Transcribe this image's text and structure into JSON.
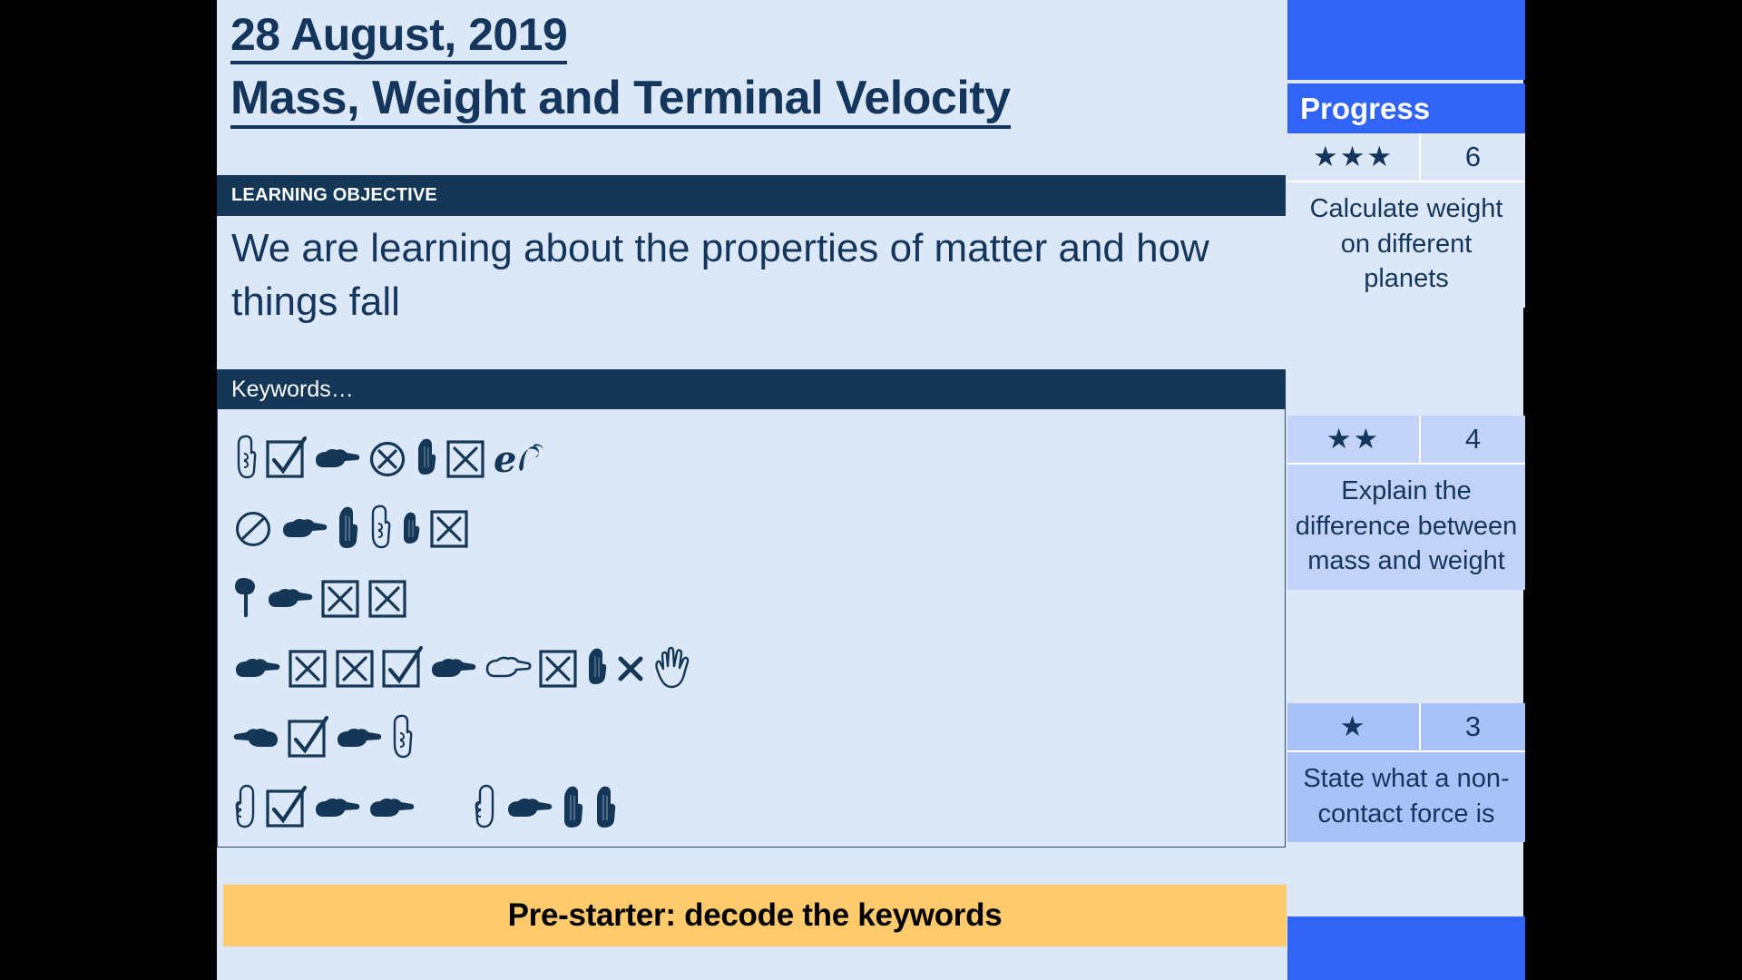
{
  "slide": {
    "date_title": "28 August, 2019",
    "topic_title": "Mass, Weight and Terminal Velocity",
    "learning_objective_label": "LEARNING OBJECTIVE",
    "learning_objective_text": "We are learning about the properties of matter and how things fall",
    "keywords_label": "Keywords…",
    "banner_text": "Pre-starter: decode the keywords",
    "colors": {
      "slide_background": "#dce8f7",
      "dark_bar": "#143757",
      "title_text": "#14365c",
      "banner_background": "#ffca6b",
      "banner_text": "#000000",
      "panel_accent": "#3163f5"
    }
  },
  "keywords_cipher": {
    "note": "Wingdings-style symbol rows that encode hidden keywords",
    "rows": [
      {
        "groups": [
          {
            "symbols": [
              "hand-point-down-outline",
              "checkbox-checked",
              "hand-point-right-filled",
              "circle-x",
              "hand-point-up-filled-small",
              "checkbox-x",
              "ampersand-script"
            ]
          }
        ]
      },
      {
        "groups": [
          {
            "symbols": [
              "circle-slash",
              "hand-point-right-filled",
              "hand-point-up-filled",
              "hand-point-down-outline",
              "hand-point-up-filled-short",
              "checkbox-x"
            ]
          }
        ]
      },
      {
        "groups": [
          {
            "symbols": [
              "hand-point-down-filled-small",
              "hand-point-right-filled",
              "checkbox-x",
              "checkbox-x"
            ]
          }
        ]
      },
      {
        "groups": [
          {
            "symbols": [
              "hand-point-right-filled",
              "checkbox-x",
              "checkbox-x",
              "checkbox-checked",
              "hand-point-right-filled",
              "hand-point-right-outline",
              "checkbox-x",
              "hand-point-up-filled-small",
              "x-mark",
              "open-hand-outline"
            ]
          }
        ]
      },
      {
        "groups": [
          {
            "symbols": [
              "hand-point-left-filled",
              "checkbox-checked",
              "hand-point-right-filled",
              "hand-point-down-outline"
            ]
          }
        ]
      },
      {
        "groups": [
          {
            "symbols": [
              "hand-point-up-outline",
              "checkbox-checked",
              "hand-point-right-filled",
              "hand-point-right-filled"
            ]
          },
          {
            "symbols": [
              "hand-point-up-outline",
              "hand-point-right-filled",
              "hand-point-up-filled",
              "hand-point-up-filled"
            ]
          }
        ]
      }
    ]
  },
  "progress_panel": {
    "title": "Progress",
    "levels": [
      {
        "stars": "★★★",
        "score": "6",
        "description": "Calculate weight on different planets"
      },
      {
        "stars": "★★",
        "score": "4",
        "description": "Explain the difference between mass and weight"
      },
      {
        "stars": "★",
        "score": "3",
        "description": "State what a non-contact force is"
      }
    ]
  }
}
